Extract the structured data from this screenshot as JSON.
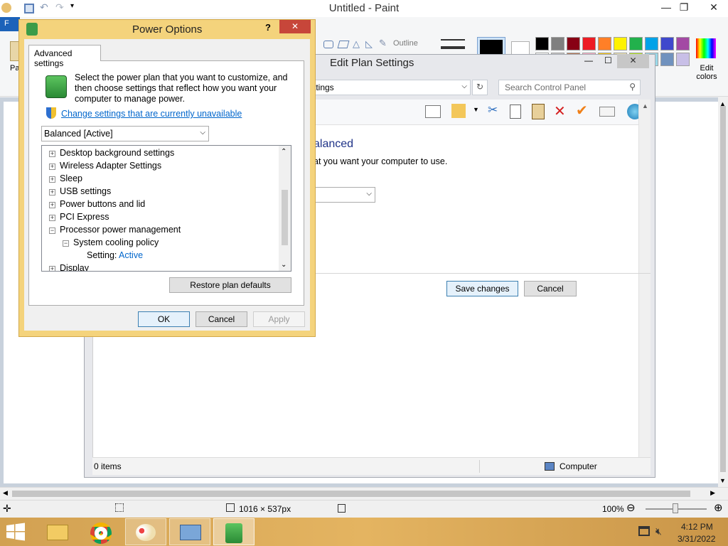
{
  "paint": {
    "title": "Untitled - Paint",
    "file_tab": "F",
    "paste_partial": "Pa",
    "outline_label": "Outline",
    "edit_colors": "Edit colors",
    "status_dimensions": "1016 × 537px",
    "zoom": "100%",
    "palette": [
      "#000000",
      "#7f7f7f",
      "#880015",
      "#ed1c24",
      "#ff7f27",
      "#fff200",
      "#22b14c",
      "#00a2e8",
      "#3f48cc",
      "#a349a4",
      "#ffffff",
      "#c3c3c3",
      "#b97a57",
      "#ffaec9",
      "#ffc90e",
      "#efe4b0",
      "#b5e61d",
      "#99d9ea",
      "#7092be",
      "#c8bfe7"
    ]
  },
  "eps": {
    "title": "Edit Plan Settings",
    "address_text": "ttings",
    "search_placeholder": "Search Control Panel",
    "heading_partial": "alanced",
    "description_partial": "at you want your computer to use.",
    "save_button": "Save changes",
    "cancel_button": "Cancel",
    "status_items": "0 items",
    "status_computer": "Computer"
  },
  "power_options": {
    "title": "Power Options",
    "help": "?",
    "tab": "Advanced settings",
    "intro": "Select the power plan that you want to customize, and then choose settings that reflect how you want your computer to manage power.",
    "change_link": "Change settings that are currently unavailable",
    "plan_select": "Balanced [Active]",
    "tree": [
      {
        "label": "Desktop background settings",
        "exp": "+"
      },
      {
        "label": "Wireless Adapter Settings",
        "exp": "+"
      },
      {
        "label": "Sleep",
        "exp": "+"
      },
      {
        "label": "USB settings",
        "exp": "+"
      },
      {
        "label": "Power buttons and lid",
        "exp": "+"
      },
      {
        "label": "PCI Express",
        "exp": "+"
      },
      {
        "label": "Processor power management",
        "exp": "−"
      }
    ],
    "sub_item": "System cooling policy",
    "setting_label": "Setting:",
    "setting_value": "Active",
    "partial_item": "Display",
    "restore_button": "Restore plan defaults",
    "ok_button": "OK",
    "cancel_button": "Cancel",
    "apply_button": "Apply"
  },
  "taskbar": {
    "time": "4:12 PM",
    "date": "3/31/2022"
  }
}
